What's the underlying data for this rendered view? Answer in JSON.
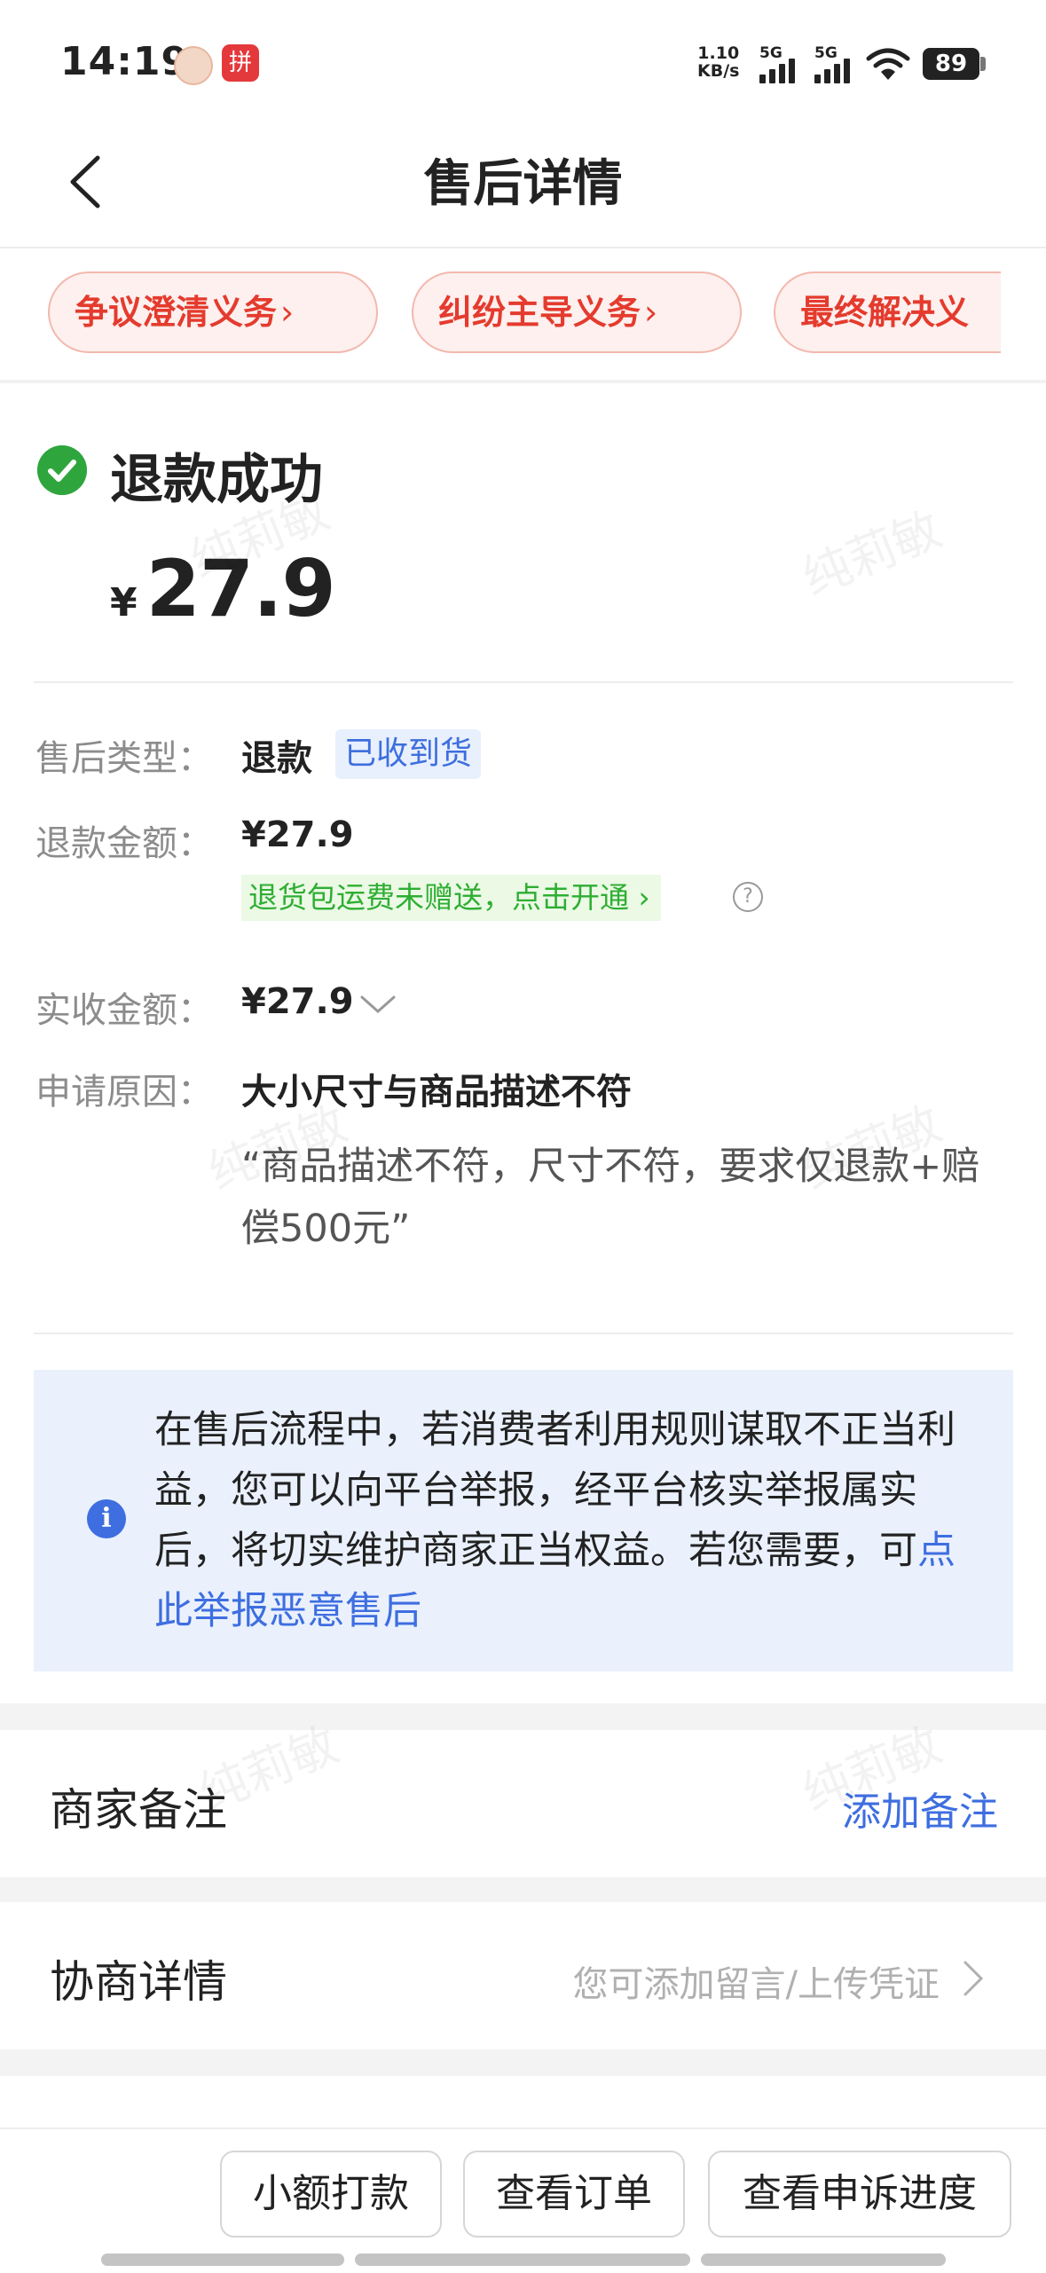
{
  "status_bar": {
    "time": "14:19",
    "app_icon_label": "拼",
    "net_speed_value": "1.10",
    "net_speed_unit": "KB/s",
    "sim1": "5G",
    "sim2": "5G",
    "battery": "89"
  },
  "header": {
    "title": "售后详情"
  },
  "chips": [
    {
      "label": "争议澄清义务"
    },
    {
      "label": "纠纷主导义务"
    },
    {
      "label": "最终解决义"
    }
  ],
  "chip_arrow": "›",
  "status": {
    "title": "退款成功",
    "currency": "¥",
    "amount": "27.9"
  },
  "details": {
    "type": {
      "label": "售后类型：",
      "value": "退款",
      "tag": "已收到货"
    },
    "refund": {
      "label": "退款金额：",
      "value": "¥27.9",
      "promo": "退货包运费未赠送，点击开通 ›"
    },
    "received": {
      "label": "实收金额：",
      "value": "¥27.9"
    },
    "reason": {
      "label": "申请原因：",
      "value": "大小尺寸与商品描述不符",
      "quote": "“商品描述不符，尺寸不符，要求仅退款+赔偿500元”"
    }
  },
  "info": {
    "text": "在售后流程中，若消费者利用规则谋取不正当利益，您可以向平台举报，经平台核实举报属实后，将切实维护商家正当权益。若您需要，可",
    "link": "点此举报恶意售后"
  },
  "merchant_note": {
    "title": "商家备注",
    "action": "添加备注"
  },
  "negotiation": {
    "title": "协商详情",
    "hint": "您可添加留言/上传凭证"
  },
  "bottom_buttons": [
    {
      "label": "小额打款"
    },
    {
      "label": "查看订单"
    },
    {
      "label": "查看申诉进度"
    }
  ],
  "watermark": "纯莉敏",
  "colors": {
    "accent_red": "#e43b2e",
    "success_green": "#2fa63d",
    "link_blue": "#3e6ee0",
    "promo_green": "#2fae33"
  }
}
